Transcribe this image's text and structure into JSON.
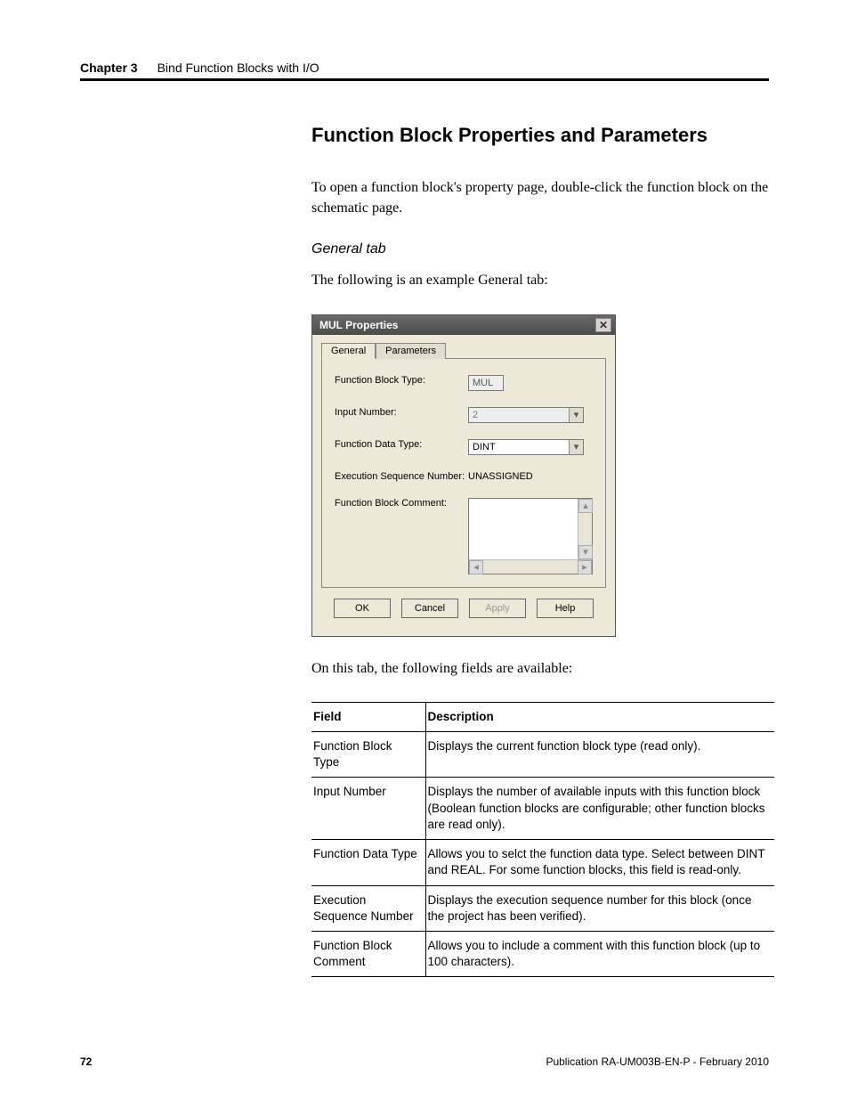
{
  "header": {
    "chapter": "Chapter 3",
    "title": "Bind Function Blocks with I/O"
  },
  "section": {
    "heading": "Function Block Properties and Parameters",
    "intro": "To open a function block's property page, double-click the function block on the schematic page.",
    "subhead": "General tab",
    "sublead": "The following is an example General tab:",
    "post_dialog": "On this tab, the following fields are available:"
  },
  "dialog": {
    "title": "MUL Properties",
    "tabs": {
      "general": "General",
      "parameters": "Parameters"
    },
    "labels": {
      "fb_type": "Function Block Type:",
      "input_number": "Input Number:",
      "fn_data_type": "Function Data Type:",
      "exec_seq": "Execution Sequence Number:",
      "fb_comment": "Function Block Comment:"
    },
    "values": {
      "fb_type": "MUL",
      "input_number": "2",
      "fn_data_type": "DINT",
      "exec_seq": "UNASSIGNED",
      "fb_comment": ""
    },
    "buttons": {
      "ok": "OK",
      "cancel": "Cancel",
      "apply": "Apply",
      "help": "Help"
    }
  },
  "table": {
    "head_field": "Field",
    "head_desc": "Description",
    "rows": [
      {
        "field": "Function Block Type",
        "desc": "Displays the current function block type (read only)."
      },
      {
        "field": "Input Number",
        "desc": "Displays the number of available inputs with this function block (Boolean function blocks are configurable; other function blocks are read only)."
      },
      {
        "field": "Function Data Type",
        "desc": "Allows you to selct the function data type. Select between DINT and REAL. For some function blocks, this field is read-only."
      },
      {
        "field": "Execution Sequence Number",
        "desc": "Displays the execution sequence number for this block (once the project has been verified)."
      },
      {
        "field": "Function Block Comment",
        "desc": "Allows you to include a comment with this function block (up to 100 characters)."
      }
    ]
  },
  "footer": {
    "page": "72",
    "pub": "Publication RA-UM003B-EN-P - February 2010"
  }
}
